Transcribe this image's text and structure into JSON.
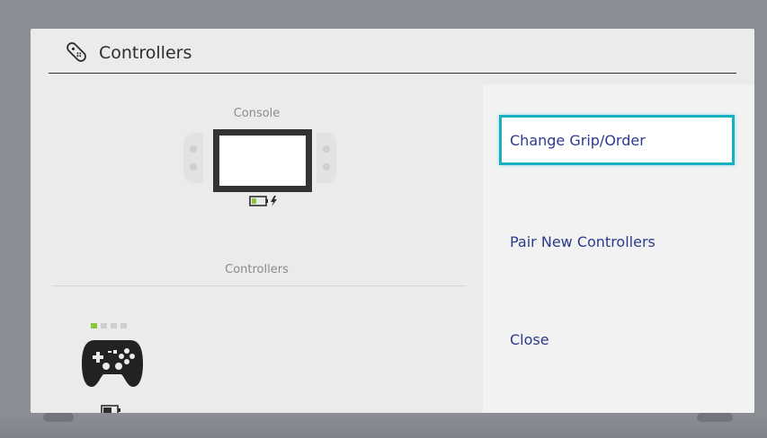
{
  "header": {
    "title": "Controllers",
    "icon": "joycon-icon"
  },
  "console": {
    "label": "Console",
    "battery_state": "low-charging",
    "colors": {
      "screen_frame": "#333333",
      "battery_fill": "#8cc63f"
    }
  },
  "controllers": {
    "label": "Controllers",
    "player_indicator": {
      "count": 4,
      "active": 1
    },
    "controller_type": "pro-controller-icon",
    "battery_state": "medium"
  },
  "menu": {
    "items": [
      {
        "label": "Change Grip/Order",
        "selected": true
      },
      {
        "label": "Pair New Controllers",
        "selected": false
      },
      {
        "label": "Close",
        "selected": false
      }
    ],
    "colors": {
      "text": "#2c3a8c",
      "focus_border": "#1ab0c4"
    }
  }
}
